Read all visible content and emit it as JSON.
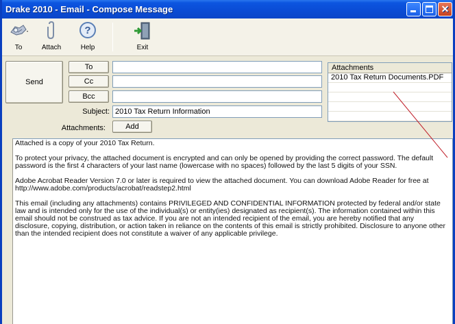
{
  "window": {
    "title": "Drake 2010 - Email - Compose Message"
  },
  "toolbar": {
    "to_label": "To",
    "attach_label": "Attach",
    "help_label": "Help",
    "exit_label": "Exit"
  },
  "compose": {
    "send_label": "Send",
    "to_button": "To",
    "cc_button": "Cc",
    "bcc_button": "Bcc",
    "to_value": "",
    "cc_value": "",
    "bcc_value": "",
    "subject_label": "Subject:",
    "subject_value": "2010 Tax Return Information",
    "attachments_label": "Attachments:",
    "add_label": "Add"
  },
  "attachments": {
    "header": "Attachments",
    "items": [
      "2010 Tax Return Documents.PDF",
      "",
      "",
      "",
      ""
    ]
  },
  "message": {
    "paragraphs": [
      "Attached is a copy of your 2010 Tax Return.",
      "To protect your privacy, the attached document is encrypted and can only be opened by providing the correct password. The default password is the first 4 characters of your last name (lowercase with no spaces) followed by the last 5 digits of your SSN.",
      "Adobe Acrobat Reader Version 7.0 or later is required to view the attached document. You can download Adobe Reader for free at http://www.adobe.com/products/acrobat/readstep2.html",
      "This email (including any attachments) contains PRIVILEGED AND CONFIDENTIAL INFORMATION protected by federal and/or state law and is intended only for the use of the individual(s) or entity(ies) designated as recipient(s). The information contained within this email should not be construed as tax advice. If you are not an intended recipient of the email, you are hereby notified that any disclosure, copying, distribution, or action taken in reliance on the contents of this email is strictly prohibited. Disclosure to anyone other than the intended recipient does not constitute a waiver of any applicable privilege."
    ]
  },
  "colors": {
    "titlebar": "#0a4bd4",
    "window_bg": "#ece9d8",
    "callout_line": "#c0202a"
  }
}
